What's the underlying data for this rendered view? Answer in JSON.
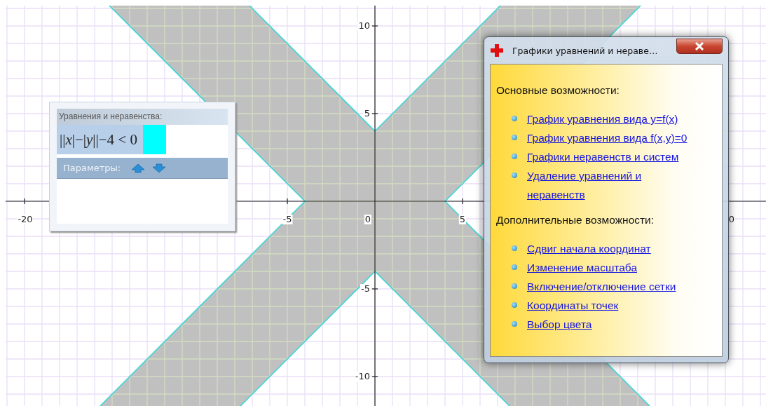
{
  "plot": {
    "x_tick_labels": [
      "-20",
      "-5",
      "0",
      "5",
      "0"
    ],
    "y_tick_labels": [
      "10",
      "5",
      "-5",
      "-10"
    ]
  },
  "equations_panel": {
    "header": "Уравнения и неравенства:",
    "equations": [
      {
        "text": "||*x*|−|*y*||−4 < 0",
        "color": "#00ffff"
      }
    ],
    "parameters_label": "Параметры:"
  },
  "help_window": {
    "title": "Графики уравнений и нераве…",
    "sections": [
      {
        "heading": "Основные возможности:",
        "links": [
          "График уравнения вида y=f(x)",
          "График уравнения вида f(x,y)=0",
          "Графики неравенств и систем",
          "Удаление уравнений и неравенств"
        ]
      },
      {
        "heading": "Дополнительные возможности:",
        "links": [
          "Сдвиг начала координат",
          "Изменение масштаба",
          "Включение/отключение сетки",
          "Координаты точек",
          "Выбор цвета"
        ]
      }
    ]
  }
}
